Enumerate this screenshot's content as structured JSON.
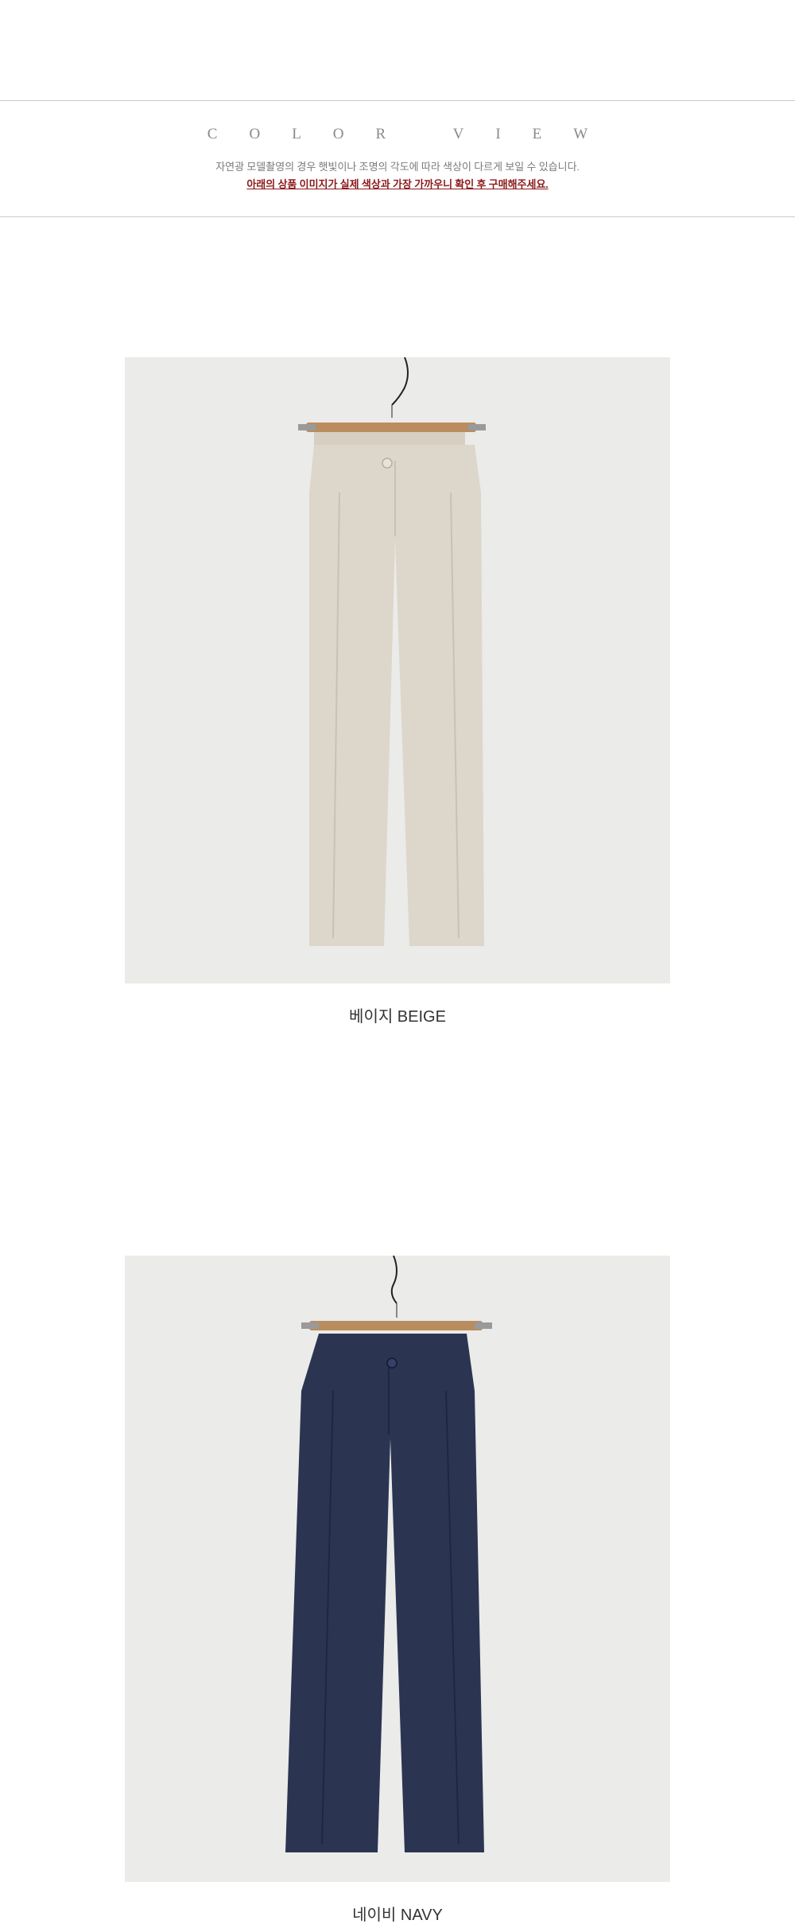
{
  "header": {
    "title": "COLOR VIEW",
    "note": "자연광 모델촬영의 경우 햇빛이나 조명의 각도에 따라 색상이 다르게 보일 수 있습니다.",
    "warning": "아래의 상품 이미지가 실제 색상과 가장 가까우니 확인 후 구매해주세요."
  },
  "colors_list": [
    {
      "name": "베이지 BEIGE",
      "fabric": "#ddd6cb",
      "shade": "#c9c1b4",
      "light": "#e8e2d8",
      "icon": "pants-hanger-image"
    },
    {
      "name": "네이비 NAVY",
      "fabric": "#2b3552",
      "shade": "#1f2740",
      "light": "#36416a",
      "icon": "pants-hanger-image"
    }
  ],
  "colors": {
    "background": "#ffffff",
    "photo_background": "#ebebe9",
    "title_text": "#8a8a8a",
    "note_text": "#7a7a7a",
    "warning_text": "#8b1a1a",
    "caption_text": "#333333",
    "hanger_wood": "#b98d5e"
  }
}
